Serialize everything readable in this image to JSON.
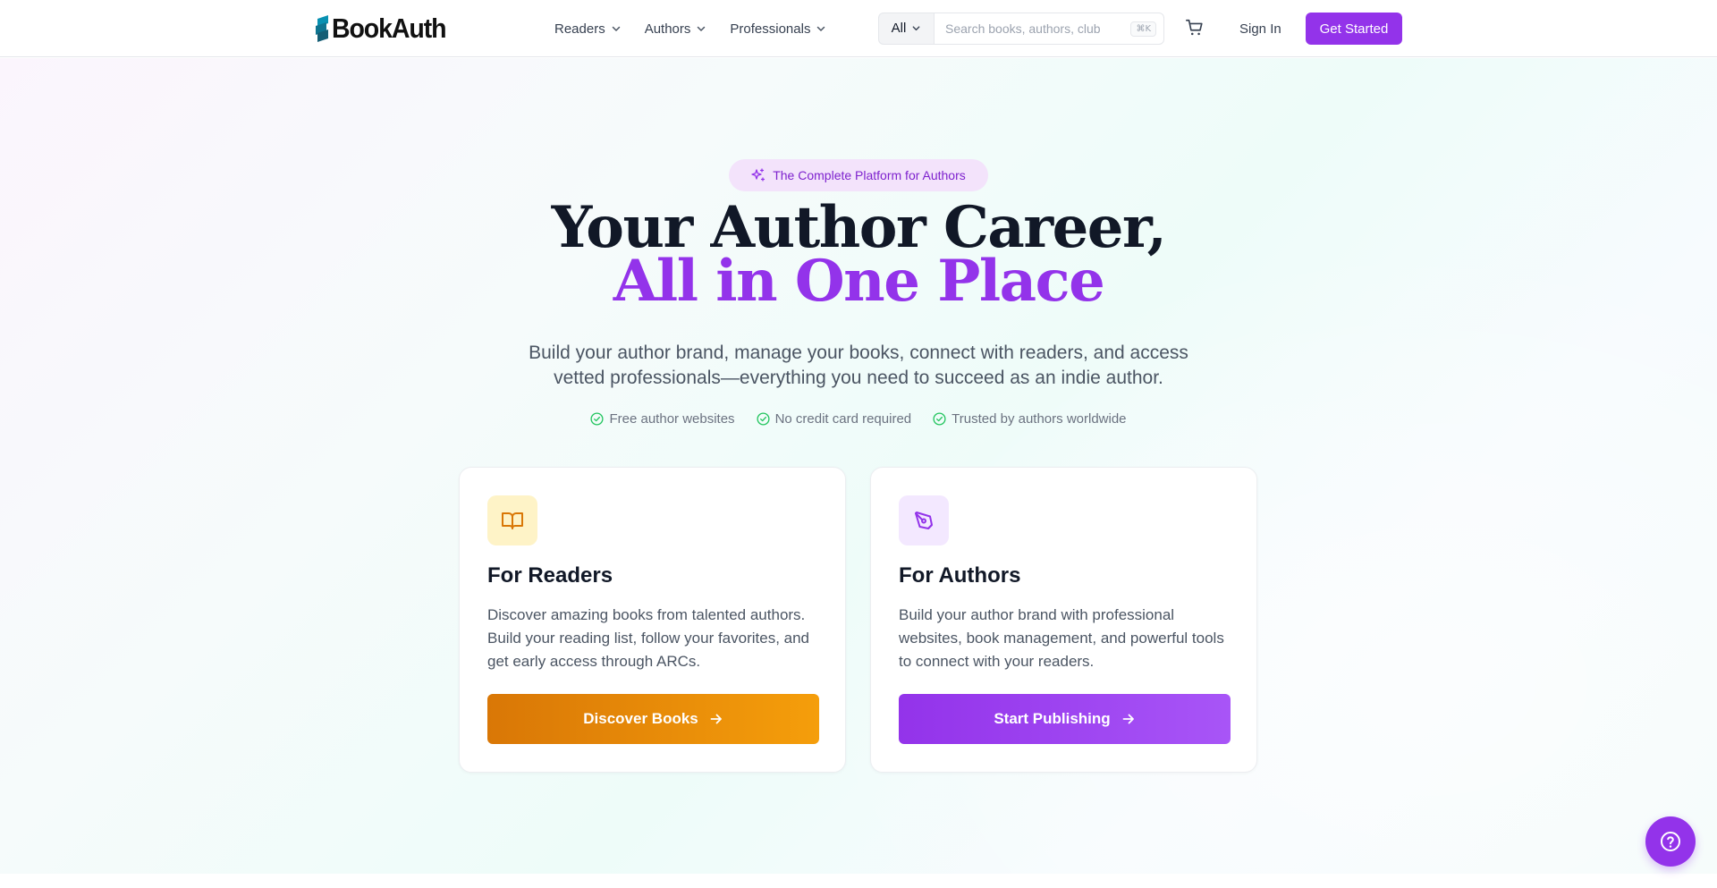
{
  "brand": {
    "name": "BookAuth",
    "colors": {
      "primary": "#9333ea",
      "accent_orange": "#d97706",
      "logo_teal": "#0e7490"
    }
  },
  "nav": {
    "items": [
      {
        "label": "Readers",
        "icon": "chevron-down-icon"
      },
      {
        "label": "Authors",
        "icon": "chevron-down-icon"
      },
      {
        "label": "Professionals",
        "icon": "chevron-down-icon"
      }
    ],
    "search": {
      "scope": "All",
      "placeholder": "Search books, authors, club",
      "shortcut": "⌘K"
    },
    "cart_icon": "shopping-cart-icon",
    "sign_in": "Sign In",
    "get_started": "Get Started"
  },
  "hero": {
    "badge": {
      "icon": "sparkles-icon",
      "label": "The Complete Platform for Authors"
    },
    "title_line1": "Your Author Career,",
    "title_line2": "All in One Place",
    "lead": "Build your author brand, manage your books, connect with readers, and access vetted professionals—everything you need to succeed as an indie author.",
    "checks": [
      {
        "icon": "check-circle-icon",
        "label": "Free author websites"
      },
      {
        "icon": "check-circle-icon",
        "label": "No credit card required"
      },
      {
        "icon": "check-circle-icon",
        "label": "Trusted by authors worldwide"
      }
    ]
  },
  "cards": {
    "readers": {
      "icon": "book-open-icon",
      "title": "For Readers",
      "text": "Discover amazing books from talented authors. Build your reading list, follow your favorites, and get early access through ARCs.",
      "button": "Discover Books"
    },
    "authors": {
      "icon": "pen-tool-icon",
      "title": "For Authors",
      "text": "Build your author brand with professional websites, book management, and powerful tools to connect with your readers.",
      "button": "Start Publishing"
    }
  },
  "help_button": {
    "icon": "help-circle-icon"
  }
}
